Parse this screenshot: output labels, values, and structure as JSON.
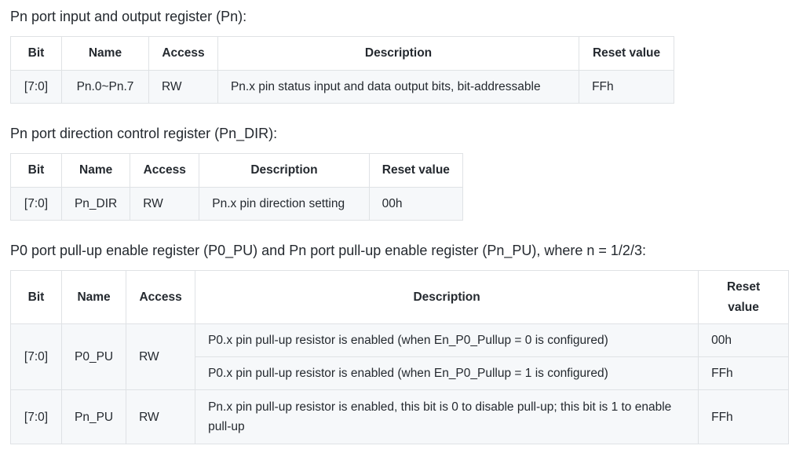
{
  "section1": {
    "heading": "Pn port input and output register (Pn):",
    "headers": [
      "Bit",
      "Name",
      "Access",
      "Description",
      "Reset value"
    ],
    "row": {
      "bit": "[7:0]",
      "name": "Pn.0~Pn.7",
      "access": "RW",
      "description": "Pn.x pin status input and data output bits, bit-addressable",
      "reset": "FFh"
    }
  },
  "section2": {
    "heading": "Pn port direction control register (Pn_DIR):",
    "headers": [
      "Bit",
      "Name",
      "Access",
      "Description",
      "Reset value"
    ],
    "row": {
      "bit": "[7:0]",
      "name": "Pn_DIR",
      "access": "RW",
      "description": "Pn.x pin direction setting",
      "reset": "00h"
    }
  },
  "section3": {
    "heading": "P0 port pull-up enable register (P0_PU) and Pn port pull-up enable register (Pn_PU), where n = 1/2/3:",
    "headers": [
      "Bit",
      "Name",
      "Access",
      "Description",
      "Reset value"
    ],
    "rows": [
      {
        "bit": "[7:0]",
        "name": "P0_PU",
        "access": "RW",
        "description": "P0.x pin pull-up resistor is enabled (when En_P0_Pullup = 0 is configured)",
        "reset": "00h"
      },
      {
        "description": "P0.x pin pull-up resistor is enabled (when En_P0_Pullup = 1 is configured)",
        "reset": "FFh"
      },
      {
        "bit": "[7:0]",
        "name": "Pn_PU",
        "access": "RW",
        "description": "Pn.x pin pull-up resistor is enabled, this bit is 0 to disable pull-up; this bit is 1 to enable pull-up",
        "reset": "FFh"
      }
    ]
  }
}
